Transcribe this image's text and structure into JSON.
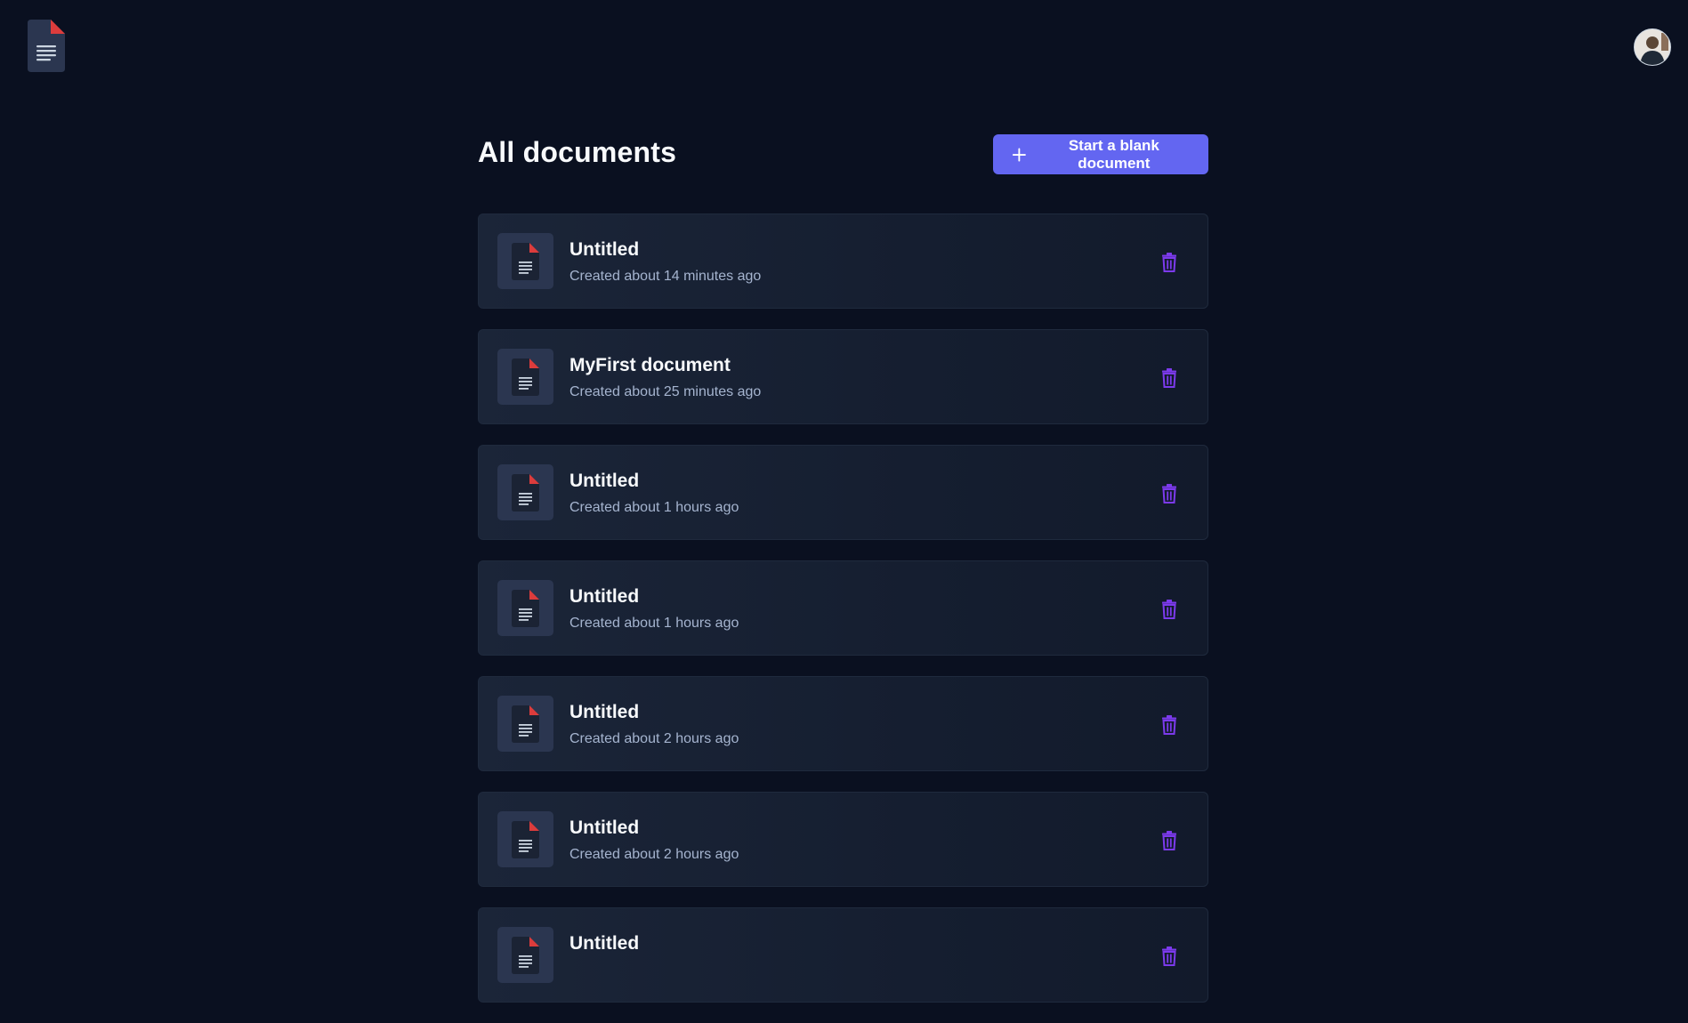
{
  "header": {
    "logo_icon": "document-icon",
    "avatar_icon": "user-avatar"
  },
  "main": {
    "title": "All documents",
    "new_button_label": "Start a blank document",
    "new_button_icon": "plus-icon"
  },
  "colors": {
    "background": "#0a1020",
    "accent": "#6366f1",
    "delete": "#7c3aed",
    "doc_corner": "#dc3c3c"
  },
  "documents": [
    {
      "title": "Untitled",
      "meta": "Created about 14 minutes ago"
    },
    {
      "title": "MyFirst document",
      "meta": "Created about 25 minutes ago"
    },
    {
      "title": "Untitled",
      "meta": "Created about 1 hours ago"
    },
    {
      "title": "Untitled",
      "meta": "Created about 1 hours ago"
    },
    {
      "title": "Untitled",
      "meta": "Created about 2 hours ago"
    },
    {
      "title": "Untitled",
      "meta": "Created about 2 hours ago"
    },
    {
      "title": "Untitled",
      "meta": ""
    }
  ]
}
